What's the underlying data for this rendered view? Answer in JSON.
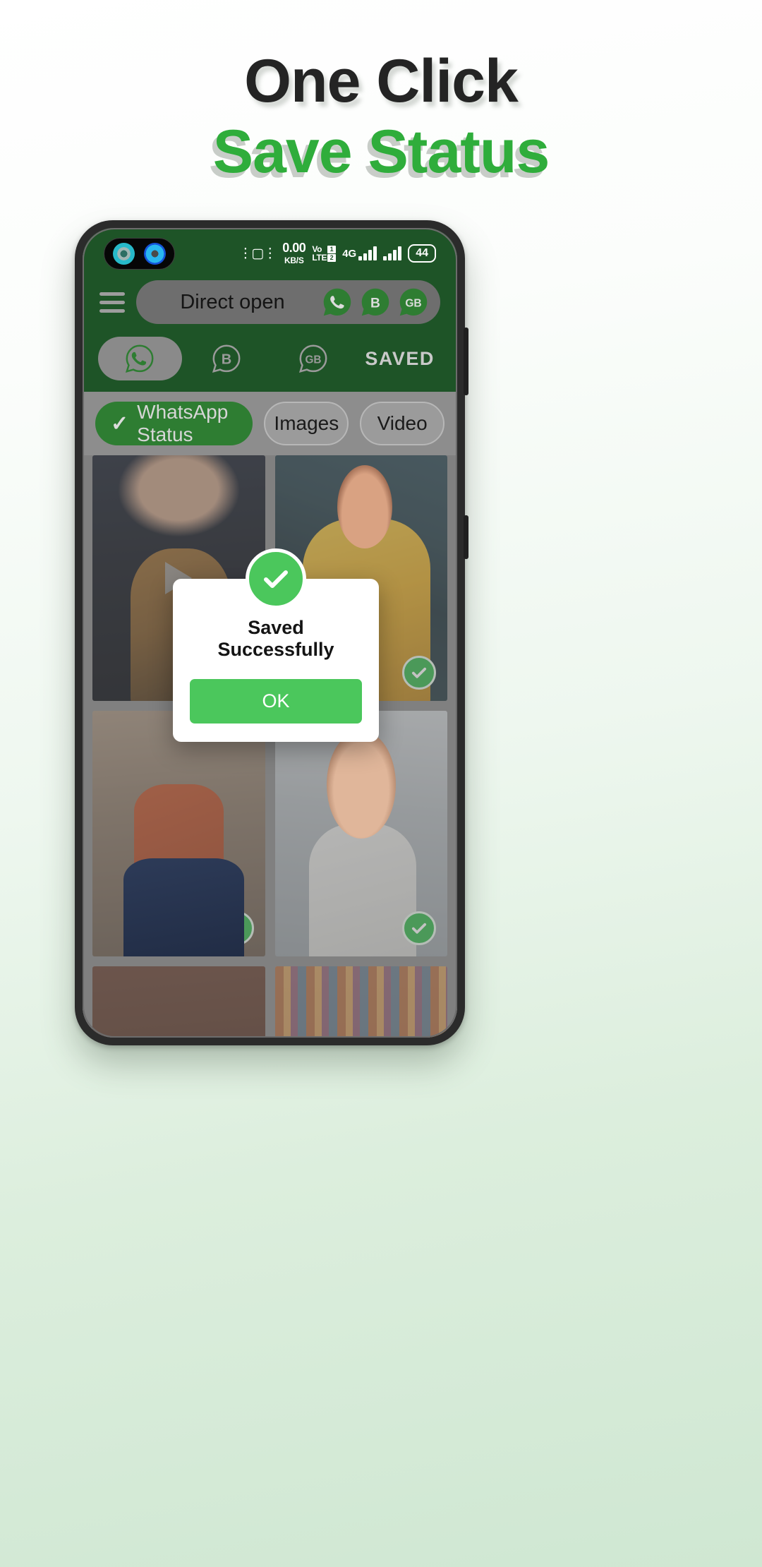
{
  "promo": {
    "headline_line1": "One Click",
    "headline_line2": "Save Status",
    "accent_color": "#2FAD3B",
    "headline_color": "#242424"
  },
  "statusbar": {
    "vibrate_icon": "vibrate-icon",
    "net_speed_value": "0.00",
    "net_speed_unit": "KB/S",
    "volte_line1": "Vo",
    "volte_line2": "LTE",
    "sim1_badge": "1",
    "sim2_badge": "2",
    "network_type": "4G",
    "battery_percent": "44"
  },
  "appbar": {
    "menu_icon": "hamburger-menu-icon",
    "direct_open_label": "Direct open",
    "shortcuts": [
      {
        "name": "whatsapp",
        "glyph": "phone"
      },
      {
        "name": "whatsapp-business",
        "glyph": "B"
      },
      {
        "name": "gb-whatsapp",
        "glyph": "GB"
      }
    ]
  },
  "tabs": [
    {
      "key": "whatsapp",
      "glyph": "phone",
      "active": true
    },
    {
      "key": "business",
      "glyph": "B",
      "active": false
    },
    {
      "key": "gb",
      "glyph": "GB",
      "active": false
    }
  ],
  "tabs_saved_label": "SAVED",
  "filters": [
    {
      "label": "WhatsApp Status",
      "selected": true,
      "check_icon": "check-icon"
    },
    {
      "label": "Images",
      "selected": false
    },
    {
      "label": "Video",
      "selected": false
    }
  ],
  "gallery": [
    {
      "id": "item-1",
      "type": "video",
      "saved": false,
      "play_icon": "play-icon"
    },
    {
      "id": "item-2",
      "type": "image",
      "saved": true
    },
    {
      "id": "item-3",
      "type": "image",
      "saved": true
    },
    {
      "id": "item-4",
      "type": "image",
      "saved": true
    },
    {
      "id": "item-5",
      "type": "video",
      "saved": false,
      "play_icon": "play-icon"
    },
    {
      "id": "item-6",
      "type": "image",
      "saved": false
    }
  ],
  "dialog": {
    "check_icon": "check-circle-icon",
    "title": "Saved Successfully",
    "ok_label": "OK",
    "button_color": "#4BC75C"
  }
}
